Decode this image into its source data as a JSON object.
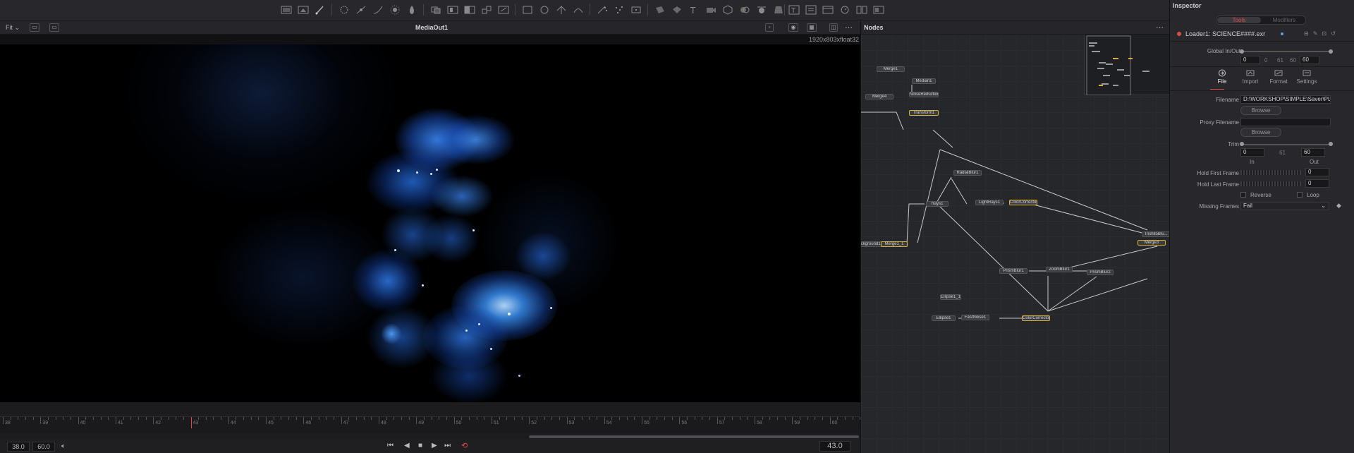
{
  "viewer": {
    "fit_label": "Fit",
    "title": "MediaOut1",
    "resolution": "1920x803xfloat32",
    "timeline_labels": [
      "38",
      "39",
      "40",
      "41",
      "42",
      "43",
      "44",
      "45",
      "46",
      "47",
      "48",
      "49",
      "50",
      "51",
      "52",
      "53",
      "54",
      "55",
      "56",
      "57",
      "58",
      "59",
      "60"
    ],
    "current_frame_marker": "43",
    "start_field": "38.0",
    "end_field": "60.0",
    "current_frame_field": "43.0"
  },
  "nodes": {
    "title": "Nodes",
    "items": [
      "Merge1",
      "Median1",
      "Merge4",
      "NoiseReduction1",
      "Transform1",
      "RadialBlur1",
      "Rays1",
      "LightRays1",
      "ColorCorrector1",
      "TrishitoBlu...",
      "Merge3",
      "Background1",
      "Merge1_1",
      "PrismBlur1",
      "ZoomBlur1",
      "PrismBlur2",
      "Ellipse1_1",
      "Ellipse1",
      "FastNoise1",
      "ColorCorrector2"
    ]
  },
  "inspector": {
    "title": "Inspector",
    "tab_tools": "Tools",
    "tab_modifiers": "Modifiers",
    "tool_name": "Loader1: SCIENCE####.exr",
    "global_label": "Global In/Out",
    "global_values": [
      "0",
      "0",
      "61",
      "60",
      "60"
    ],
    "subtabs": [
      "File",
      "Import",
      "Format",
      "Settings"
    ],
    "filename_label": "Filename",
    "filename_value": "D:\\WORKSHOP\\SIMPLE\\Saver\\PLANE",
    "browse_label": "Browse",
    "proxy_label": "Proxy Filename",
    "proxy_browse_label": "Browse",
    "trim_label": "Trim",
    "trim_in": "0",
    "trim_mid": "61",
    "trim_out": "60",
    "in_label": "In",
    "out_label": "Out",
    "hold_first_label": "Hold First Frame",
    "hold_first_value": "0",
    "hold_last_label": "Hold Last Frame",
    "hold_last_value": "0",
    "reverse_label": "Reverse",
    "loop_label": "Loop",
    "missing_label": "Missing Frames",
    "missing_value": "Fail"
  },
  "colors": {
    "accent_red": "#e04a4a",
    "selected_yellow": "#d6b13a",
    "image_blue": "#2f7dff"
  }
}
